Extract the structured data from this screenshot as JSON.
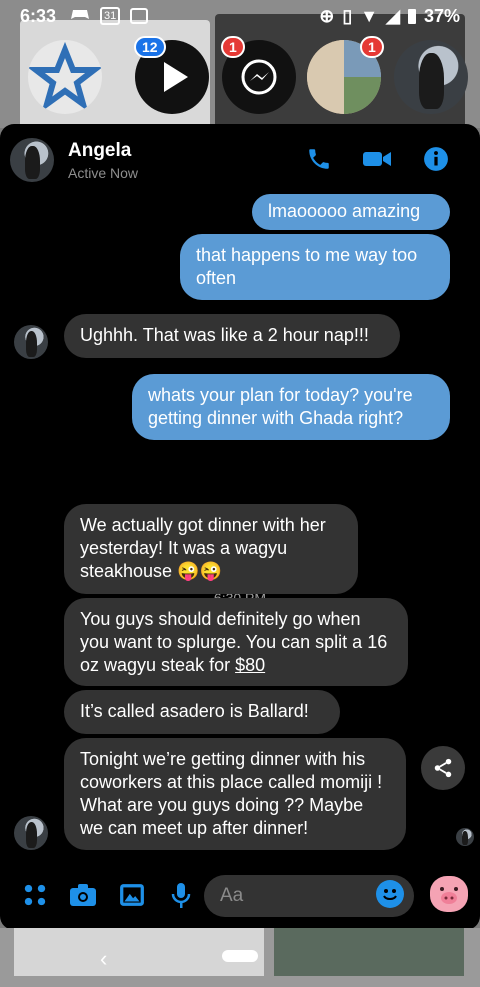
{
  "status_bar": {
    "time": "6:33",
    "calendar_day": "31",
    "battery": "37%"
  },
  "chat_heads": [
    {
      "name": "app-icon-star",
      "badge": ""
    },
    {
      "name": "play-icon",
      "badge": "12",
      "badge_color": "#1a73e8"
    },
    {
      "name": "messenger-icon",
      "badge": "1",
      "badge_color": "#e53935"
    },
    {
      "name": "group-chat-head",
      "badge": "1",
      "badge_color": "#e53935"
    },
    {
      "name": "angela-chat-head",
      "badge": ""
    }
  ],
  "header": {
    "name": "Angela",
    "status": "Active Now"
  },
  "messages": {
    "m1": "lmaooooo amazing",
    "m2": "that happens to me way too often",
    "m3": "Ughhh. That was like a 2 hour nap!!!",
    "m4": "whats your plan for today? you're getting dinner with Ghada right?",
    "timestamp": "6:30 PM",
    "m5": "We actually got dinner with her yesterday! It was a wagyu steakhouse 😜😜",
    "m6_text": "You guys should definitely go when you want to splurge. You can split a 16 oz wagyu steak for ",
    "m6_link": "$80",
    "m7": "It’s called asadero is Ballard!",
    "m8": "Tonight we’re getting dinner with his coworkers at this place called momiji ! What are you guys doing ?? Maybe we can meet up after dinner!"
  },
  "composer": {
    "placeholder": "Aa"
  },
  "colors": {
    "accent": "#1e90e8",
    "outgoing_bubble": "#5b9bd5",
    "incoming_bubble": "#333333"
  }
}
